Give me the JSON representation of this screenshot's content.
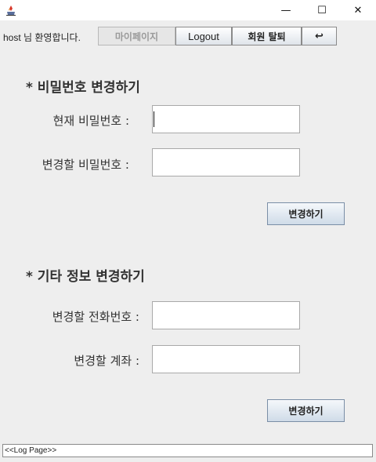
{
  "window": {
    "app_icon": "java-cup-icon",
    "minimize_glyph": "—",
    "maximize_glyph": "☐",
    "close_glyph": "✕"
  },
  "header": {
    "welcome_text": "host 님 환영합니다.",
    "mypage_label": "마이페이지",
    "logout_label": "Logout",
    "withdraw_label": "회원 탈퇴",
    "back_label": "↩"
  },
  "password_section": {
    "title": "* 비밀번호 변경하기",
    "current_label": "현재 비밀번호 :",
    "current_value": "",
    "new_label": "변경할 비밀번호 :",
    "new_value": "",
    "submit_label": "변경하기"
  },
  "info_section": {
    "title": "* 기타 정보 변경하기",
    "phone_label": "변경할 전화번호 :",
    "phone_value": "",
    "account_label": "변경할 계좌 :",
    "account_value": "",
    "submit_label": "변경하기"
  },
  "log": {
    "text": "<<Log Page>>"
  }
}
